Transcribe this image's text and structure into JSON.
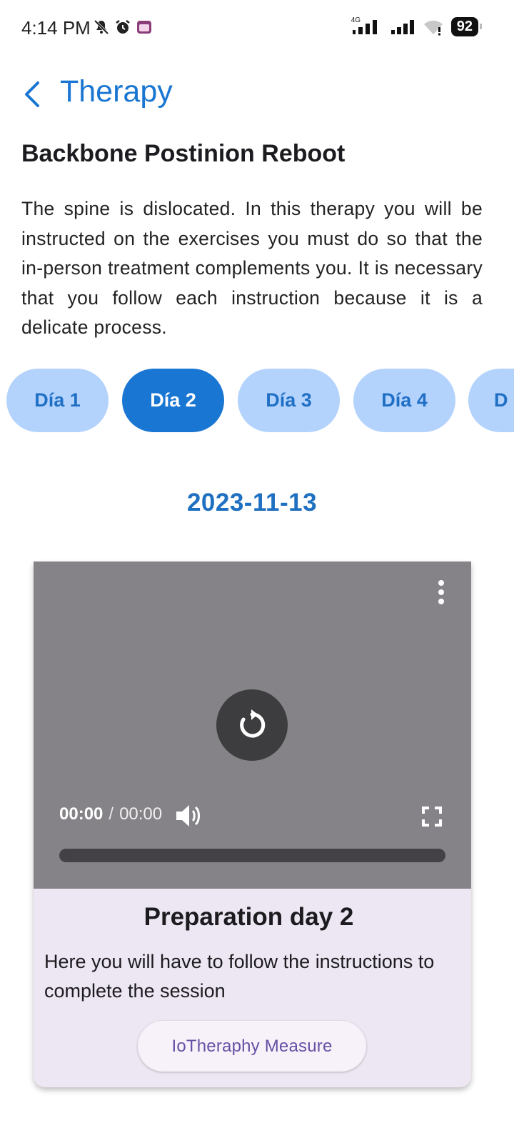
{
  "status_bar": {
    "time": "4:14 PM",
    "network_label": "4G",
    "battery": "92",
    "icons": [
      "mute-icon",
      "alarm-icon",
      "app-notification-icon",
      "signal-icon",
      "signal-icon",
      "wifi-icon",
      "battery-icon"
    ]
  },
  "header": {
    "back_icon": "chevron-left-icon",
    "title": "Therapy"
  },
  "therapy": {
    "title": "Backbone Postinion Reboot",
    "description": "The spine is dislocated. In this therapy you will be instructed on the exercises you must do so that the in-person treatment complements you. It is necessary that you follow each instruction because it is a delicate process."
  },
  "days": [
    {
      "label": "Día 1",
      "selected": false
    },
    {
      "label": "Día 2",
      "selected": true
    },
    {
      "label": "Día 3",
      "selected": false
    },
    {
      "label": "Día 4",
      "selected": false
    },
    {
      "label": "D",
      "selected": false
    }
  ],
  "date": "2023-11-13",
  "video": {
    "current_time": "00:00",
    "separator": "/",
    "total_time": "00:00",
    "progress": 0,
    "icons": {
      "menu": "more-vert-icon",
      "replay": "replay-icon",
      "volume": "volume-icon",
      "fullscreen": "fullscreen-icon"
    }
  },
  "session": {
    "title": "Preparation day 2",
    "description": "Here you will have to follow the instructions to complete the session",
    "button_label": "IoTheraphy Measure"
  },
  "colors": {
    "primary": "#1976d2",
    "chip_unselected_bg": "#b3d3fd",
    "chip_unselected_text": "#1f6fc5",
    "card_bg": "#ede7f3",
    "video_bg": "#858387",
    "button_text": "#6750a4"
  }
}
